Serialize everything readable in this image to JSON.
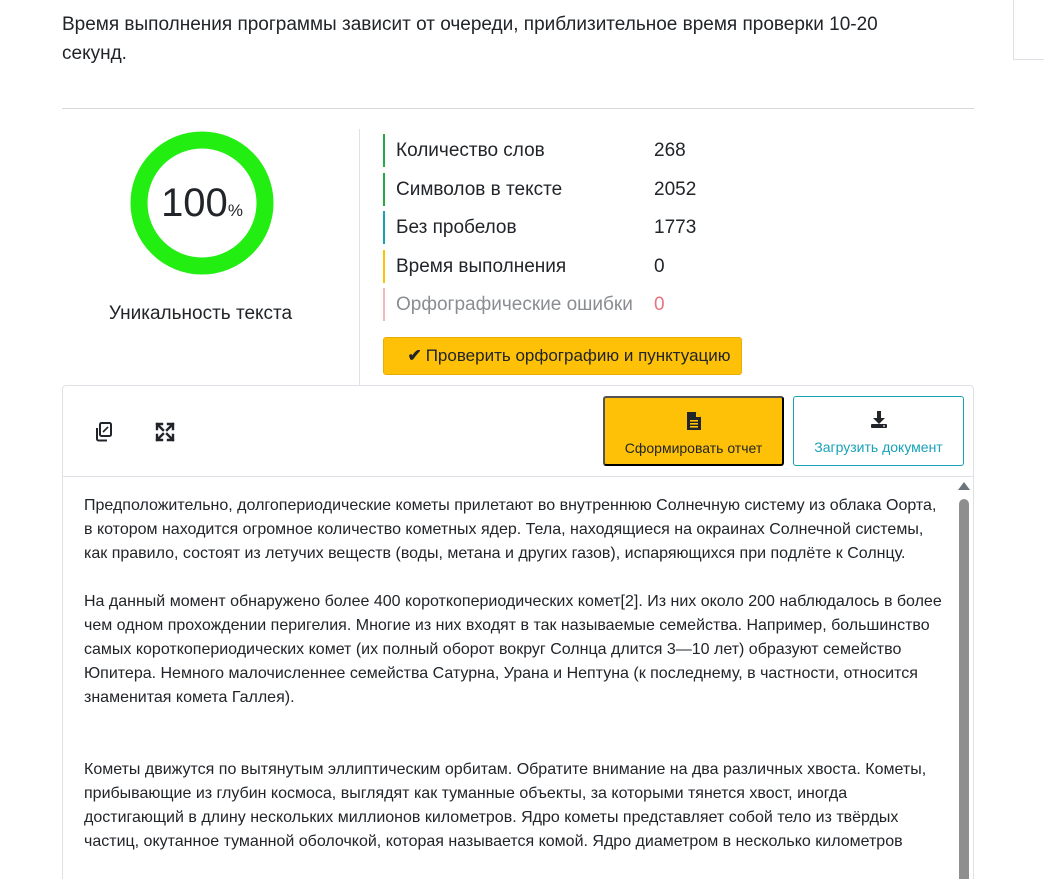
{
  "intro_text": "Время выполнения программы зависит от очереди, приблизительное время проверки 10-20 секунд.",
  "uniqueness": {
    "value": "100",
    "unit": "%",
    "fraction": 1.0,
    "caption": "Уникальность текста",
    "ring_color": "#22ee11"
  },
  "stats": [
    {
      "label": "Количество слов",
      "value": "268",
      "color": "#28a745"
    },
    {
      "label": "Символов в тексте",
      "value": "2052",
      "color": "#28a745"
    },
    {
      "label": "Без пробелов",
      "value": "1773",
      "color": "#17a2b8"
    },
    {
      "label": "Время выполнения",
      "value": "0",
      "color": "#ffc107"
    },
    {
      "label": "Орфографические ошибки",
      "value": "0",
      "color": "#f5b7bd"
    }
  ],
  "spell_check_button": "Проверить орфографию и пунктуацию",
  "toolbar": {
    "copy_icon": "copy-icon",
    "fullscreen_icon": "expand-icon",
    "report_button": "Сформировать отчет",
    "report_icon": "file-text-icon",
    "upload_button": "Загрузить документ",
    "upload_icon": "download-icon"
  },
  "document": {
    "paragraph_1": "Предположительно, долгопериодические кометы прилетают во внутреннюю Солнечную систему из облака Оорта, в котором находится огромное количество кометных ядер. Тела, находящиеся на окраинах Солнечной системы, как правило, состоят из летучих веществ (воды, метана и других газов), испаряющихся при подлёте к Солнцу.",
    "paragraph_2": "На данный момент обнаружено более 400 короткопериодических комет[2]. Из них около 200 наблюдалось в более чем одном прохождении перигелия. Многие из них входят в так называемые семейства. Например, большинство самых короткопериодических комет (их полный оборот вокруг Солнца длится 3—10 лет) образуют семейство Юпитера. Немного малочисленнее семейства Сатурна, Урана и Нептуна (к последнему, в частности, относится знаменитая комета Галлея).",
    "paragraph_3": "Кометы движутся по вытянутым эллиптическим орбитам. Обратите внимание на два различных хвоста. Кометы, прибывающие из глубин космоса, выглядят как туманные объекты, за которыми тянется хвост, иногда достигающий в длину нескольких миллионов километров. Ядро кометы представляет собой тело из твёрдых частиц, окутанное туманной оболочкой, которая называется комой. Ядро диаметром в несколько километров"
  }
}
